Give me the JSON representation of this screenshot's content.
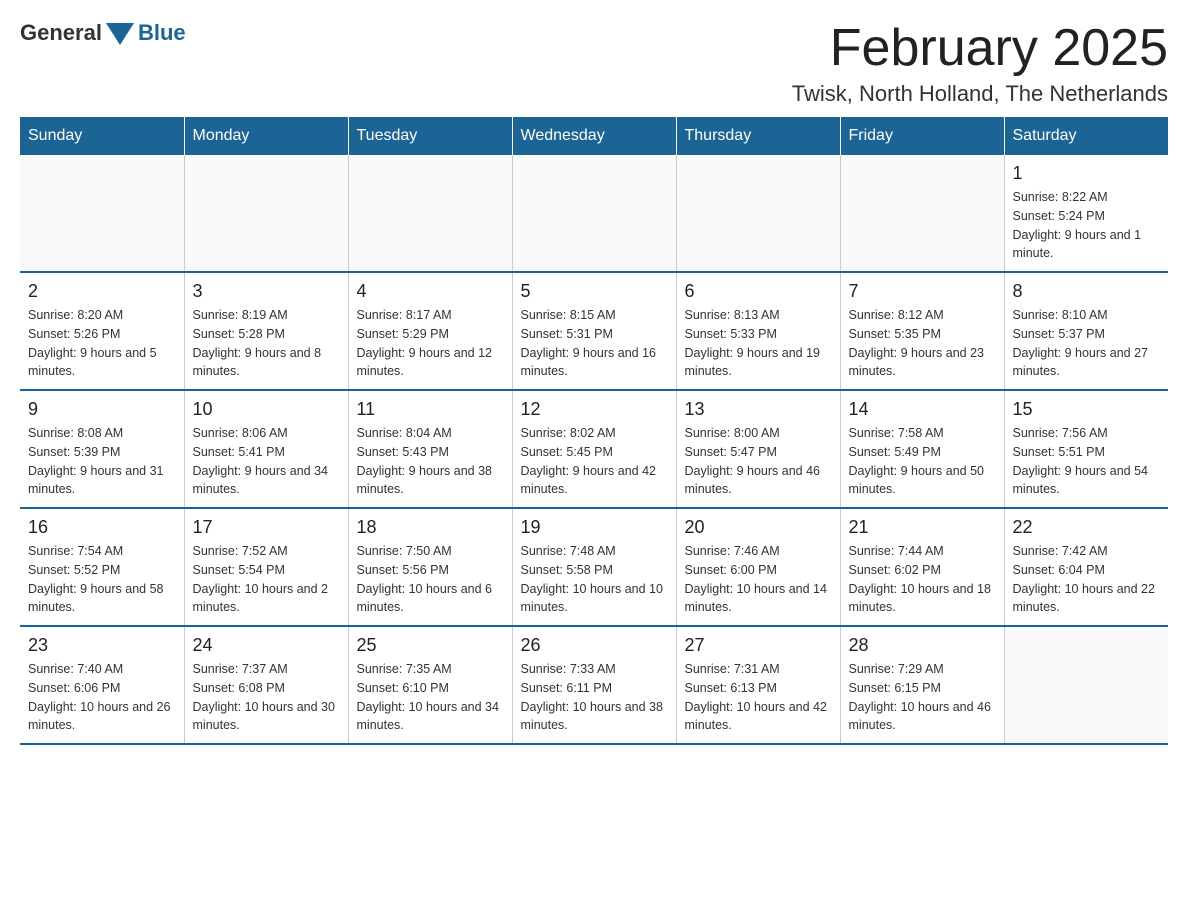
{
  "logo": {
    "general": "General",
    "blue": "Blue"
  },
  "title": "February 2025",
  "subtitle": "Twisk, North Holland, The Netherlands",
  "days_of_week": [
    "Sunday",
    "Monday",
    "Tuesday",
    "Wednesday",
    "Thursday",
    "Friday",
    "Saturday"
  ],
  "weeks": [
    [
      {
        "day": "",
        "info": ""
      },
      {
        "day": "",
        "info": ""
      },
      {
        "day": "",
        "info": ""
      },
      {
        "day": "",
        "info": ""
      },
      {
        "day": "",
        "info": ""
      },
      {
        "day": "",
        "info": ""
      },
      {
        "day": "1",
        "info": "Sunrise: 8:22 AM\nSunset: 5:24 PM\nDaylight: 9 hours and 1 minute."
      }
    ],
    [
      {
        "day": "2",
        "info": "Sunrise: 8:20 AM\nSunset: 5:26 PM\nDaylight: 9 hours and 5 minutes."
      },
      {
        "day": "3",
        "info": "Sunrise: 8:19 AM\nSunset: 5:28 PM\nDaylight: 9 hours and 8 minutes."
      },
      {
        "day": "4",
        "info": "Sunrise: 8:17 AM\nSunset: 5:29 PM\nDaylight: 9 hours and 12 minutes."
      },
      {
        "day": "5",
        "info": "Sunrise: 8:15 AM\nSunset: 5:31 PM\nDaylight: 9 hours and 16 minutes."
      },
      {
        "day": "6",
        "info": "Sunrise: 8:13 AM\nSunset: 5:33 PM\nDaylight: 9 hours and 19 minutes."
      },
      {
        "day": "7",
        "info": "Sunrise: 8:12 AM\nSunset: 5:35 PM\nDaylight: 9 hours and 23 minutes."
      },
      {
        "day": "8",
        "info": "Sunrise: 8:10 AM\nSunset: 5:37 PM\nDaylight: 9 hours and 27 minutes."
      }
    ],
    [
      {
        "day": "9",
        "info": "Sunrise: 8:08 AM\nSunset: 5:39 PM\nDaylight: 9 hours and 31 minutes."
      },
      {
        "day": "10",
        "info": "Sunrise: 8:06 AM\nSunset: 5:41 PM\nDaylight: 9 hours and 34 minutes."
      },
      {
        "day": "11",
        "info": "Sunrise: 8:04 AM\nSunset: 5:43 PM\nDaylight: 9 hours and 38 minutes."
      },
      {
        "day": "12",
        "info": "Sunrise: 8:02 AM\nSunset: 5:45 PM\nDaylight: 9 hours and 42 minutes."
      },
      {
        "day": "13",
        "info": "Sunrise: 8:00 AM\nSunset: 5:47 PM\nDaylight: 9 hours and 46 minutes."
      },
      {
        "day": "14",
        "info": "Sunrise: 7:58 AM\nSunset: 5:49 PM\nDaylight: 9 hours and 50 minutes."
      },
      {
        "day": "15",
        "info": "Sunrise: 7:56 AM\nSunset: 5:51 PM\nDaylight: 9 hours and 54 minutes."
      }
    ],
    [
      {
        "day": "16",
        "info": "Sunrise: 7:54 AM\nSunset: 5:52 PM\nDaylight: 9 hours and 58 minutes."
      },
      {
        "day": "17",
        "info": "Sunrise: 7:52 AM\nSunset: 5:54 PM\nDaylight: 10 hours and 2 minutes."
      },
      {
        "day": "18",
        "info": "Sunrise: 7:50 AM\nSunset: 5:56 PM\nDaylight: 10 hours and 6 minutes."
      },
      {
        "day": "19",
        "info": "Sunrise: 7:48 AM\nSunset: 5:58 PM\nDaylight: 10 hours and 10 minutes."
      },
      {
        "day": "20",
        "info": "Sunrise: 7:46 AM\nSunset: 6:00 PM\nDaylight: 10 hours and 14 minutes."
      },
      {
        "day": "21",
        "info": "Sunrise: 7:44 AM\nSunset: 6:02 PM\nDaylight: 10 hours and 18 minutes."
      },
      {
        "day": "22",
        "info": "Sunrise: 7:42 AM\nSunset: 6:04 PM\nDaylight: 10 hours and 22 minutes."
      }
    ],
    [
      {
        "day": "23",
        "info": "Sunrise: 7:40 AM\nSunset: 6:06 PM\nDaylight: 10 hours and 26 minutes."
      },
      {
        "day": "24",
        "info": "Sunrise: 7:37 AM\nSunset: 6:08 PM\nDaylight: 10 hours and 30 minutes."
      },
      {
        "day": "25",
        "info": "Sunrise: 7:35 AM\nSunset: 6:10 PM\nDaylight: 10 hours and 34 minutes."
      },
      {
        "day": "26",
        "info": "Sunrise: 7:33 AM\nSunset: 6:11 PM\nDaylight: 10 hours and 38 minutes."
      },
      {
        "day": "27",
        "info": "Sunrise: 7:31 AM\nSunset: 6:13 PM\nDaylight: 10 hours and 42 minutes."
      },
      {
        "day": "28",
        "info": "Sunrise: 7:29 AM\nSunset: 6:15 PM\nDaylight: 10 hours and 46 minutes."
      },
      {
        "day": "",
        "info": ""
      }
    ]
  ]
}
